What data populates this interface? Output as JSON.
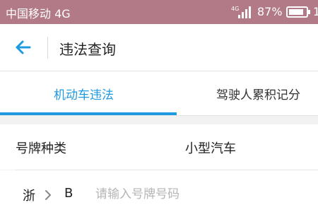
{
  "status_bar": {
    "carrier": "中国移动 4G",
    "network_badge": "4G",
    "battery_percent": "87%",
    "clock_fragment": "1"
  },
  "header": {
    "title": "违法查询"
  },
  "tabs": [
    {
      "label": "机动车违法",
      "active": true
    },
    {
      "label": "驾驶人累积记分",
      "active": false
    }
  ],
  "form": {
    "plate_type": {
      "label": "号牌种类",
      "value": "小型汽车"
    },
    "plate_number": {
      "province": "浙",
      "city_letter": "B",
      "placeholder": "请输入号牌号码",
      "value": ""
    }
  },
  "colors": {
    "status_bar": "#b27a86",
    "accent": "#1e9ae0",
    "background": "#f2f2f2"
  },
  "icons": {
    "back": "arrow-left-icon",
    "signal": "signal-icon",
    "battery": "battery-icon",
    "chevron": "chevron-right-icon"
  }
}
